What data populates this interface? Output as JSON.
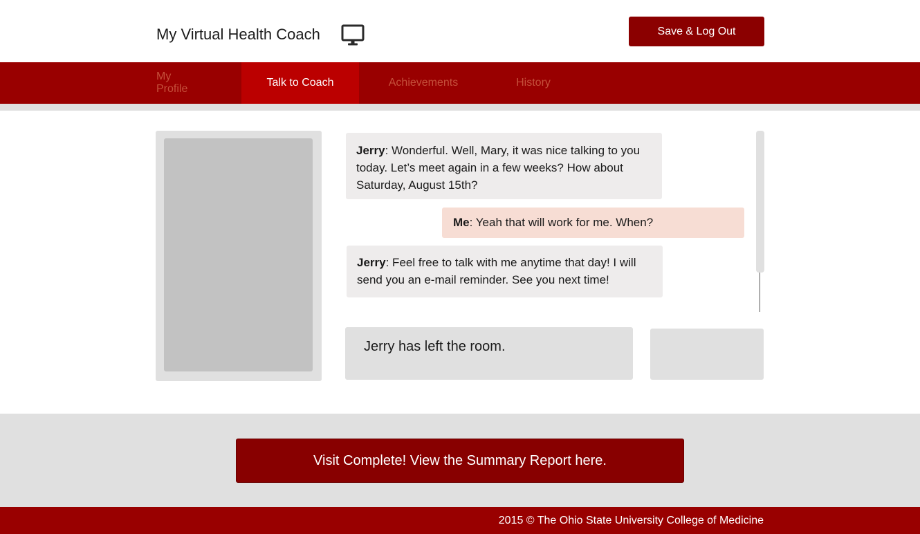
{
  "header": {
    "title": "My Virtual Health Coach",
    "icon": "monitor-icon",
    "logout_label": "Save & Log Out"
  },
  "nav": {
    "tabs": [
      {
        "label": "My Profile",
        "active": false
      },
      {
        "label": "Talk to Coach",
        "active": true
      },
      {
        "label": "Achievements",
        "active": false
      },
      {
        "label": "History",
        "active": false
      }
    ]
  },
  "chat": {
    "messages": [
      {
        "speaker": "Jerry",
        "text": ": Wonderful. Well, Mary, it was nice talking to you today. Let’s meet again in a few weeks? How about Saturday, August 15th?"
      },
      {
        "speaker": "Me",
        "text": ": Yeah that will work for me. When?"
      },
      {
        "speaker": "Jerry",
        "text": ": Feel free to talk with me anytime that day! I will send you an e-mail reminder. See you next time!"
      }
    ],
    "status": "Jerry has left the room."
  },
  "summary_button": "Visit Complete! View the Summary Report here.",
  "footer": {
    "copyright": "2015 © The Ohio State University College of Medicine"
  },
  "colors": {
    "brand_dark": "#8b0000",
    "nav_bg": "#990000",
    "tab_active": "#bb0000",
    "tab_inactive_text": "#c5503b",
    "coach_bubble": "#eeecec",
    "user_bubble": "#f7ddd4"
  }
}
